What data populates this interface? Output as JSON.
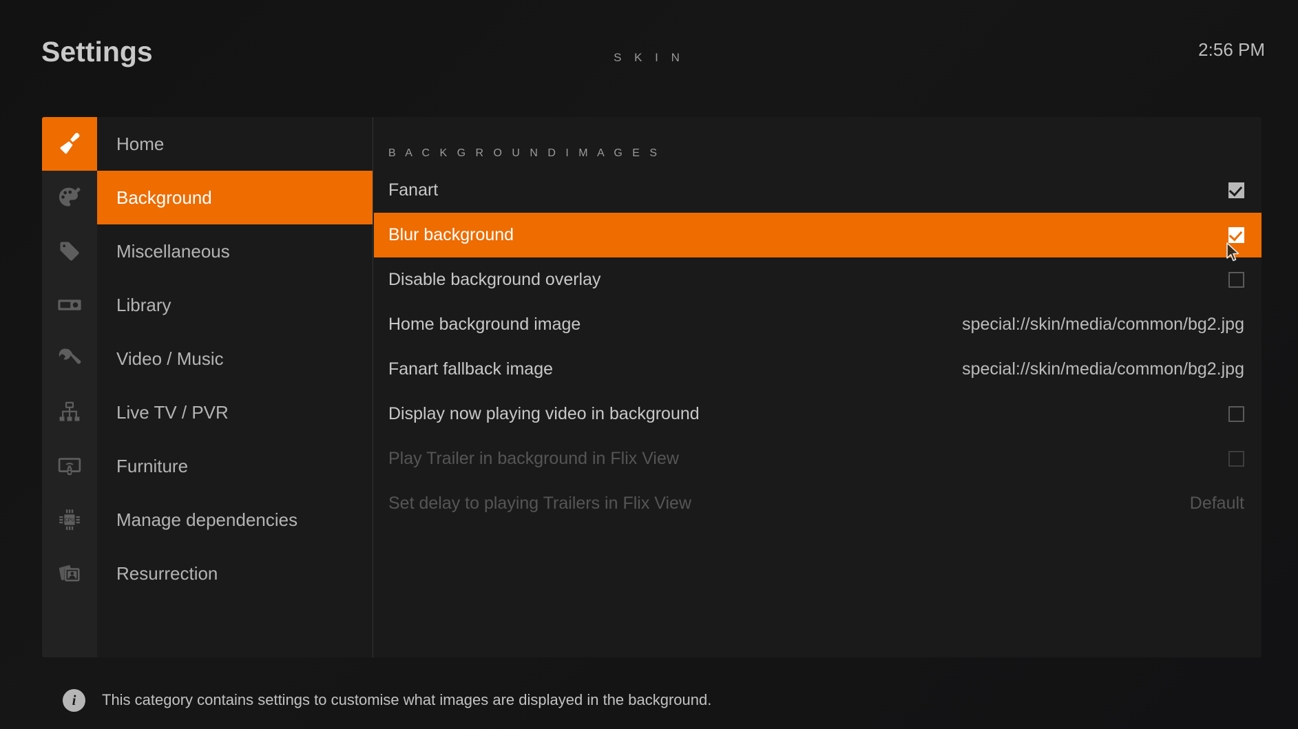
{
  "header": {
    "title": "Settings",
    "section": "S K I N",
    "clock": "2:56 PM"
  },
  "colors": {
    "accent": "#ee6c00",
    "panel_bg": "#1a1a1a",
    "rail_bg": "#222222",
    "text": "#c8c8c8",
    "text_disabled": "#555555"
  },
  "rail": {
    "items": [
      {
        "icon": "paintbrush-icon",
        "active": true
      },
      {
        "icon": "palette-icon",
        "active": false
      },
      {
        "icon": "tag-icon",
        "active": false
      },
      {
        "icon": "media-library-icon",
        "active": false
      },
      {
        "icon": "wrench-icon",
        "active": false
      },
      {
        "icon": "network-tree-icon",
        "active": false
      },
      {
        "icon": "remote-tv-icon",
        "active": false
      },
      {
        "icon": "cpu-chip-icon",
        "active": false
      },
      {
        "icon": "photos-icon",
        "active": false
      }
    ]
  },
  "categories": {
    "items": [
      {
        "label": "Home",
        "selected": false
      },
      {
        "label": "Background",
        "selected": true
      },
      {
        "label": "Miscellaneous",
        "selected": false
      },
      {
        "label": "Library",
        "selected": false
      },
      {
        "label": "Video / Music",
        "selected": false
      },
      {
        "label": "Live TV / PVR",
        "selected": false
      },
      {
        "label": "Furniture",
        "selected": false
      },
      {
        "label": "Manage dependencies",
        "selected": false
      },
      {
        "label": "Resurrection",
        "selected": false
      }
    ]
  },
  "settings": {
    "group_label": "B A C K G R O U N D   I M A G E S",
    "rows": [
      {
        "label": "Fanart",
        "control": "checkbox",
        "checked": true,
        "value": "",
        "selected": false,
        "disabled": false
      },
      {
        "label": "Blur background",
        "control": "checkbox",
        "checked": true,
        "value": "",
        "selected": true,
        "disabled": false
      },
      {
        "label": "Disable background overlay",
        "control": "checkbox",
        "checked": false,
        "value": "",
        "selected": false,
        "disabled": false
      },
      {
        "label": "Home background image",
        "control": "text",
        "checked": false,
        "value": "special://skin/media/common/bg2.jpg",
        "selected": false,
        "disabled": false
      },
      {
        "label": "Fanart fallback image",
        "control": "text",
        "checked": false,
        "value": "special://skin/media/common/bg2.jpg",
        "selected": false,
        "disabled": false
      },
      {
        "label": "Display now playing video in background",
        "control": "checkbox",
        "checked": false,
        "value": "",
        "selected": false,
        "disabled": false
      },
      {
        "label": "Play Trailer in background in Flix View",
        "control": "checkbox",
        "checked": false,
        "value": "",
        "selected": false,
        "disabled": true
      },
      {
        "label": "Set delay to playing Trailers in Flix View",
        "control": "text",
        "checked": false,
        "value": "Default",
        "selected": false,
        "disabled": true
      }
    ]
  },
  "footer": {
    "icon": "info-icon",
    "text": "This category contains settings to customise what images are displayed in the background."
  }
}
